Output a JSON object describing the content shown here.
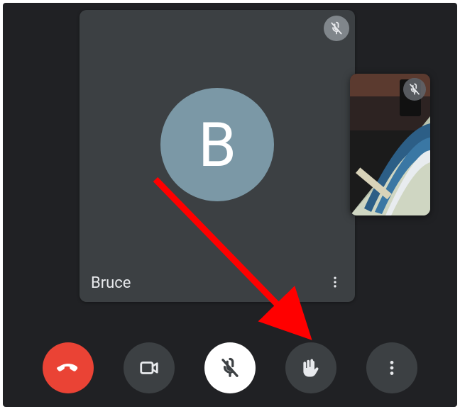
{
  "participant": {
    "name": "Bruce",
    "initial": "B",
    "muted": true
  },
  "self_view": {
    "muted": true
  },
  "controls": {
    "hangup": "hangup",
    "camera": "camera-toggle",
    "mic": "mic-toggle",
    "raise_hand": "raise-hand",
    "more": "more-options"
  },
  "colors": {
    "bg": "#202124",
    "tile": "#3c4043",
    "avatar": "#7b98a6",
    "hangup": "#ea4335",
    "annotation": "#ff0000"
  },
  "annotation": {
    "target": "raise-hand-button"
  }
}
